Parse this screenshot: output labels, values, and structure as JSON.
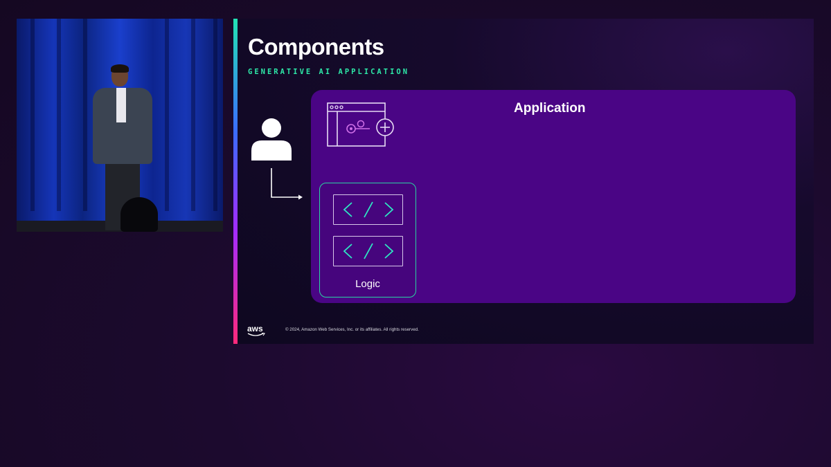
{
  "slide": {
    "title": "Components",
    "subtitle": "GENERATIVE AI APPLICATION",
    "application_label": "Application",
    "logic_label": "Logic",
    "footer": {
      "logo_text": "aws",
      "copyright": "© 2024, Amazon Web Services, Inc. or its affiliates. All rights reserved."
    }
  },
  "icons": {
    "user": "user-icon",
    "app_window": "app-window-gears-plus-icon",
    "code": "code-brackets-icon",
    "arrow": "connector-arrow-icon"
  },
  "colors": {
    "subtitle": "#2ee8a8",
    "application_box": "#4a0585",
    "logic_border": "#2ad4a2",
    "code_glyph": "#2ee8c4",
    "accent_gradient": [
      "#22e3b4",
      "#3b6cff",
      "#a22cff",
      "#ff2a7a"
    ]
  }
}
